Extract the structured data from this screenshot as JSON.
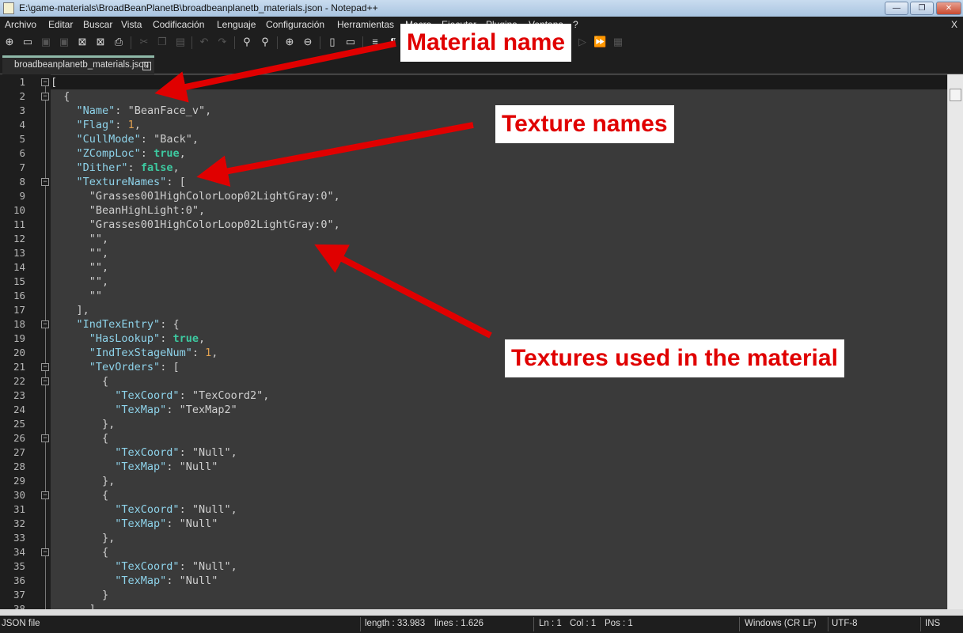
{
  "window": {
    "title": "E:\\game-materials\\BroadBeanPlanetB\\broadbeanplanetb_materials.json - Notepad++",
    "minimize": "—",
    "restore": "❐",
    "close": "✕"
  },
  "menu": {
    "items": [
      "Archivo",
      "Editar",
      "Buscar",
      "Vista",
      "Codificación",
      "Lenguaje",
      "Configuración",
      "Herramientas",
      "Macro",
      "Ejecutar",
      "Plugins",
      "Ventana",
      "?"
    ],
    "close_doc": "X"
  },
  "toolbar": {
    "icons": [
      "new-file",
      "open",
      "save",
      "save-all",
      "close",
      "close-all",
      "print",
      "cut",
      "copy",
      "paste",
      "undo",
      "redo",
      "find",
      "replace",
      "zoom-in",
      "zoom-out",
      "sync-scroll",
      "wrap",
      "indent-guide",
      "show-all-chars",
      "macro-record",
      "macro-stop",
      "macro-play",
      "macro-run-multiple",
      "macro-save"
    ]
  },
  "tab": {
    "label": "broadbeanplanetb_materials.json",
    "close": "x"
  },
  "editor": {
    "lines": [
      "[",
      "  {",
      "    \"Name\": \"BeanFace_v\",",
      "    \"Flag\": 1,",
      "    \"CullMode\": \"Back\",",
      "    \"ZCompLoc\": true,",
      "    \"Dither\": false,",
      "    \"TextureNames\": [",
      "      \"Grasses001HighColorLoop02LightGray:0\",",
      "      \"BeanHighLight:0\",",
      "      \"Grasses001HighColorLoop02LightGray:0\",",
      "      \"\",",
      "      \"\",",
      "      \"\",",
      "      \"\",",
      "      \"\"",
      "    ],",
      "    \"IndTexEntry\": {",
      "      \"HasLookup\": true,",
      "      \"IndTexStageNum\": 1,",
      "      \"TevOrders\": [",
      "        {",
      "          \"TexCoord\": \"TexCoord2\",",
      "          \"TexMap\": \"TexMap2\"",
      "        },",
      "        {",
      "          \"TexCoord\": \"Null\",",
      "          \"TexMap\": \"Null\"",
      "        },",
      "        {",
      "          \"TexCoord\": \"Null\",",
      "          \"TexMap\": \"Null\"",
      "        },",
      "        {",
      "          \"TexCoord\": \"Null\",",
      "          \"TexMap\": \"Null\"",
      "        }",
      "      ],"
    ],
    "fold_lines": [
      1,
      2,
      8,
      18,
      21,
      22,
      26,
      30,
      34
    ],
    "current_line": 1
  },
  "status": {
    "filetype": "JSON file",
    "length": "length : 33.983",
    "lines": "lines : 1.626",
    "ln": "Ln : 1",
    "col": "Col : 1",
    "pos": "Pos : 1",
    "eol": "Windows (CR LF)",
    "encoding": "UTF-8",
    "mode": "INS"
  },
  "annotations": {
    "material_name": "Material name",
    "texture_names": "Texture names",
    "textures_used": "Textures used in the material",
    "color": "#e00000"
  }
}
